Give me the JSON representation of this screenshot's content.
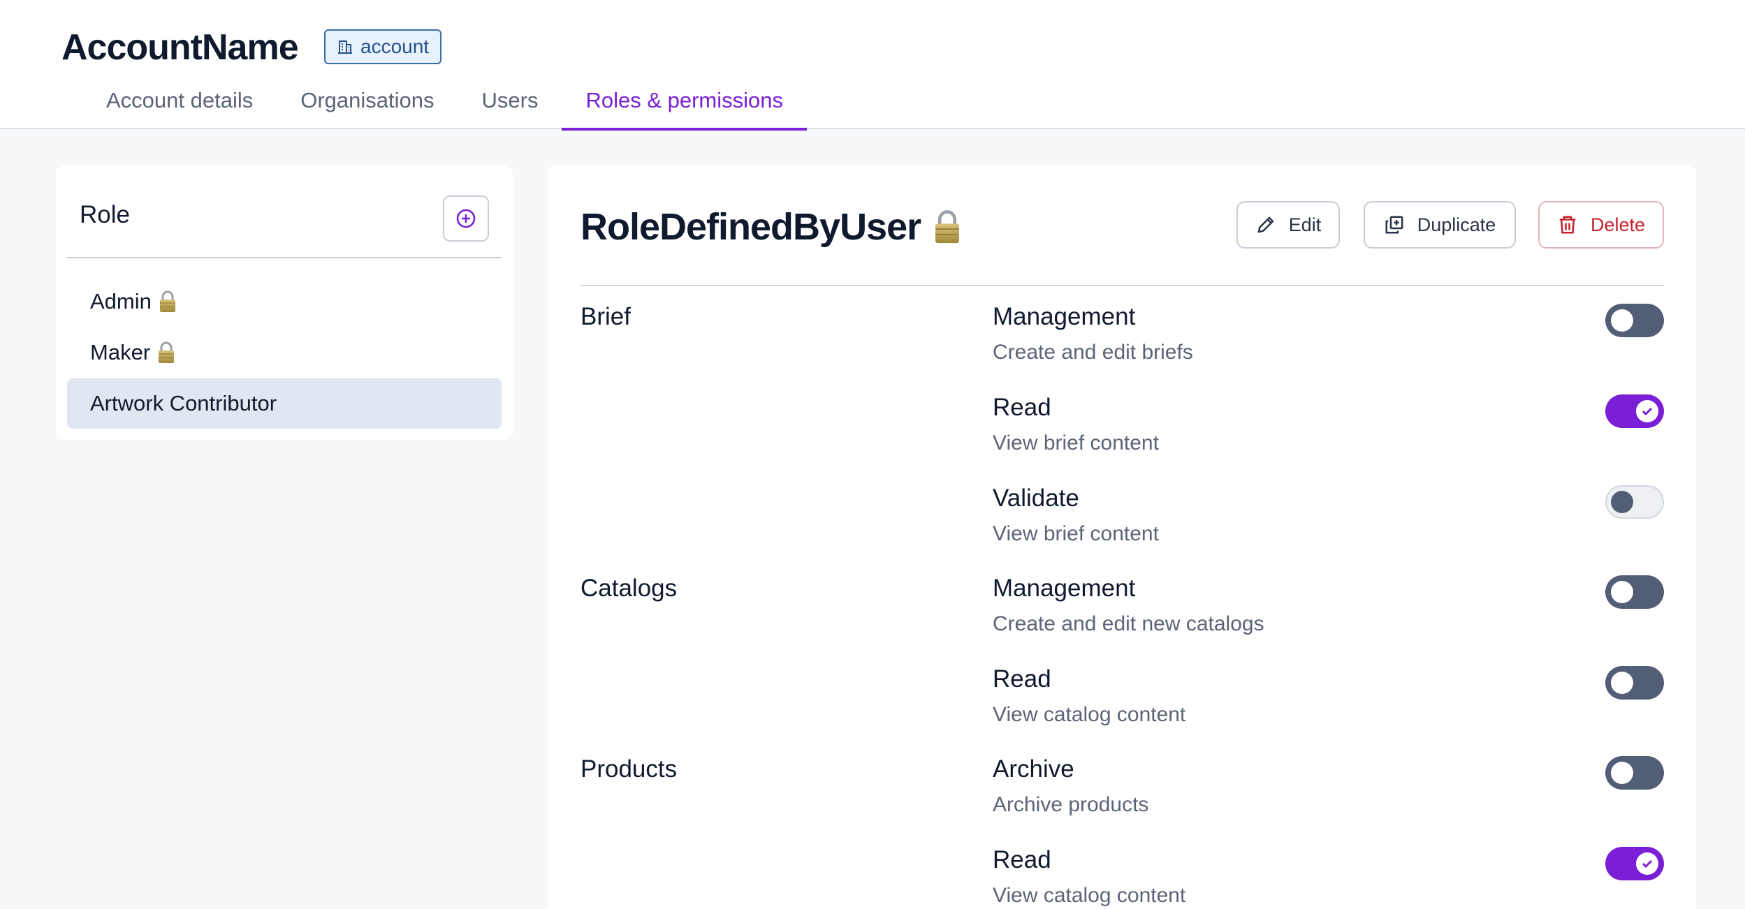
{
  "header": {
    "account_name": "AccountName",
    "badge_label": "account",
    "badge_icon": "building-icon",
    "tabs": [
      {
        "label": "Account details",
        "active": false
      },
      {
        "label": "Organisations",
        "active": false
      },
      {
        "label": "Users",
        "active": false
      },
      {
        "label": "Roles & permissions",
        "active": true
      }
    ]
  },
  "roles": {
    "title": "Role",
    "add_icon": "plus-circle-icon",
    "items": [
      {
        "label": "Admin",
        "locked": true,
        "selected": false
      },
      {
        "label": "Maker",
        "locked": true,
        "selected": false
      },
      {
        "label": "Artwork Contributor",
        "locked": false,
        "selected": true
      }
    ]
  },
  "detail": {
    "title": "RoleDefinedByUser",
    "locked": true,
    "actions": {
      "edit": "Edit",
      "duplicate": "Duplicate",
      "delete": "Delete"
    },
    "sections": [
      {
        "label": "Brief",
        "permissions": [
          {
            "name": "Management",
            "description": "Create and edit briefs",
            "state": "off"
          },
          {
            "name": "Read",
            "description": "View brief content",
            "state": "on"
          },
          {
            "name": "Validate",
            "description": "View brief content",
            "state": "disabled"
          }
        ]
      },
      {
        "label": "Catalogs",
        "permissions": [
          {
            "name": "Management",
            "description": "Create and edit new catalogs",
            "state": "off"
          },
          {
            "name": "Read",
            "description": "View catalog content",
            "state": "off"
          }
        ]
      },
      {
        "label": "Products",
        "permissions": [
          {
            "name": "Archive",
            "description": "Archive products",
            "state": "off"
          },
          {
            "name": "Read",
            "description": "View catalog content",
            "state": "on"
          }
        ]
      }
    ]
  },
  "colors": {
    "accent": "#7a1fd6",
    "danger": "#c6202c",
    "toggle_off": "#525e75",
    "badge": "#24528a"
  }
}
